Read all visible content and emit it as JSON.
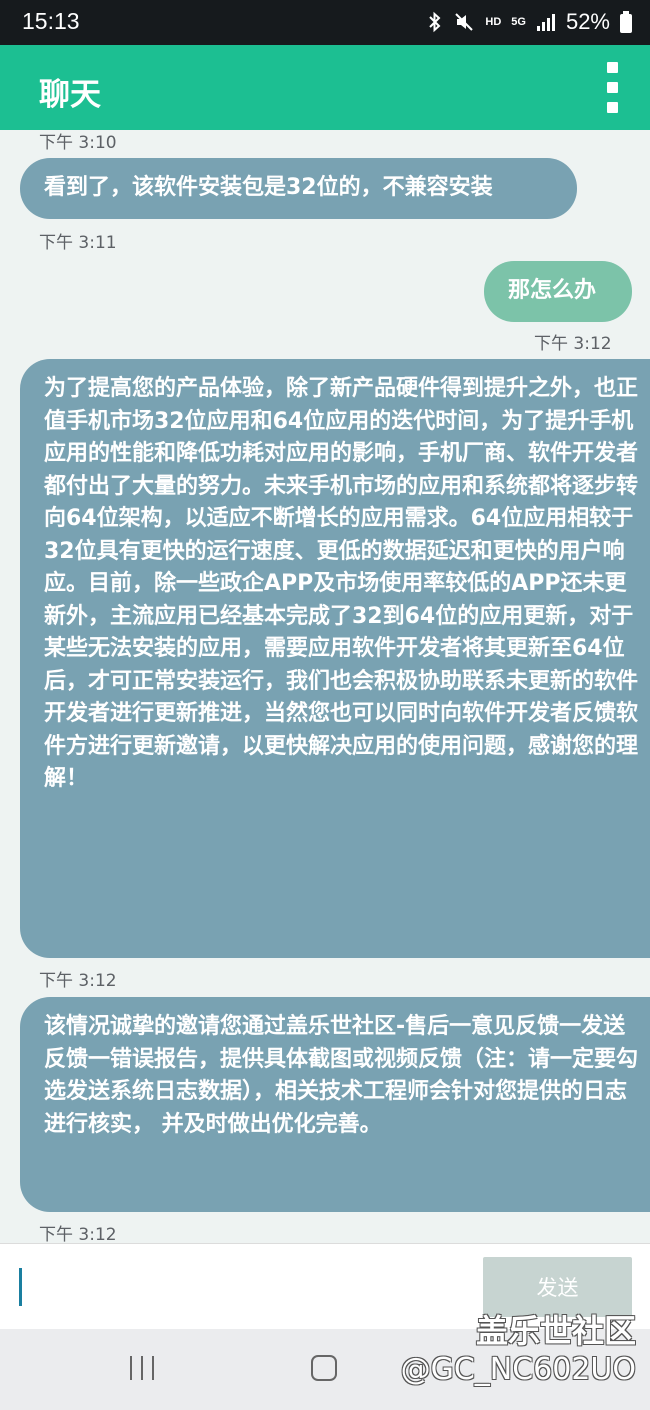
{
  "status_bar": {
    "time": "15:13",
    "network": "HD",
    "signal": "5G",
    "battery": "52%"
  },
  "app_bar": {
    "title": "聊天"
  },
  "messages": [
    {
      "direction": "incoming",
      "text": "看到了，该软件安装包是32位的，不兼容安装",
      "time": "下午 3:11"
    },
    {
      "direction": "outgoing",
      "text": "那怎么办",
      "time": "下午 3:12"
    },
    {
      "direction": "incoming",
      "text": "为了提高您的产品体验，除了新产品硬件得到提升之外，也正值手机市场32位应用和64位应用的迭代时间，为了提升手机应用的性能和降低功耗对应用的影响，手机厂商、软件开发者都付出了大量的努力。未来手机市场的应用和系统都将逐步转向64位架构，以适应不断增长的应用需求。64位应用相较于32位具有更快的运行速度、更低的数据延迟和更快的用户响应。目前，除一些政企APP及市场使用率较低的APP还未更新外，主流应用已经基本完成了32到64位的应用更新，对于某些无法安装的应用，需要应用软件开发者将其更新至64位后，才可正常安装运行，我们也会积极协助联系未更新的软件开发者进行更新推进，当然您也可以同时向软件开发者反馈软件方进行更新邀请，以更快解决应用的使用问题，感谢您的理解！",
      "time": "下午 3:12"
    },
    {
      "direction": "incoming",
      "text": "该情况诚挚的邀请您通过盖乐世社区-售后一意见反馈一发送反馈一错误报告，提供具体截图或视频反馈（注：请一定要勾选发送系统日志数据），相关技术工程师会针对您提供的日志进行核实， 并及时做出优化完善。",
      "time": "下午 3:12"
    }
  ],
  "top_partial_time": "下午 3:10",
  "input": {
    "value": "",
    "send_label": "发送"
  },
  "watermark": {
    "line1": "盖乐世社区",
    "line2": "@GC_NC602UO"
  },
  "colors": {
    "app_bar": "#1cbf92",
    "incoming_bubble": "#79a2b2",
    "outgoing_bubble": "#7cc3a9",
    "chat_background": "#eef3f2",
    "send_button": "#c7d4d1"
  }
}
